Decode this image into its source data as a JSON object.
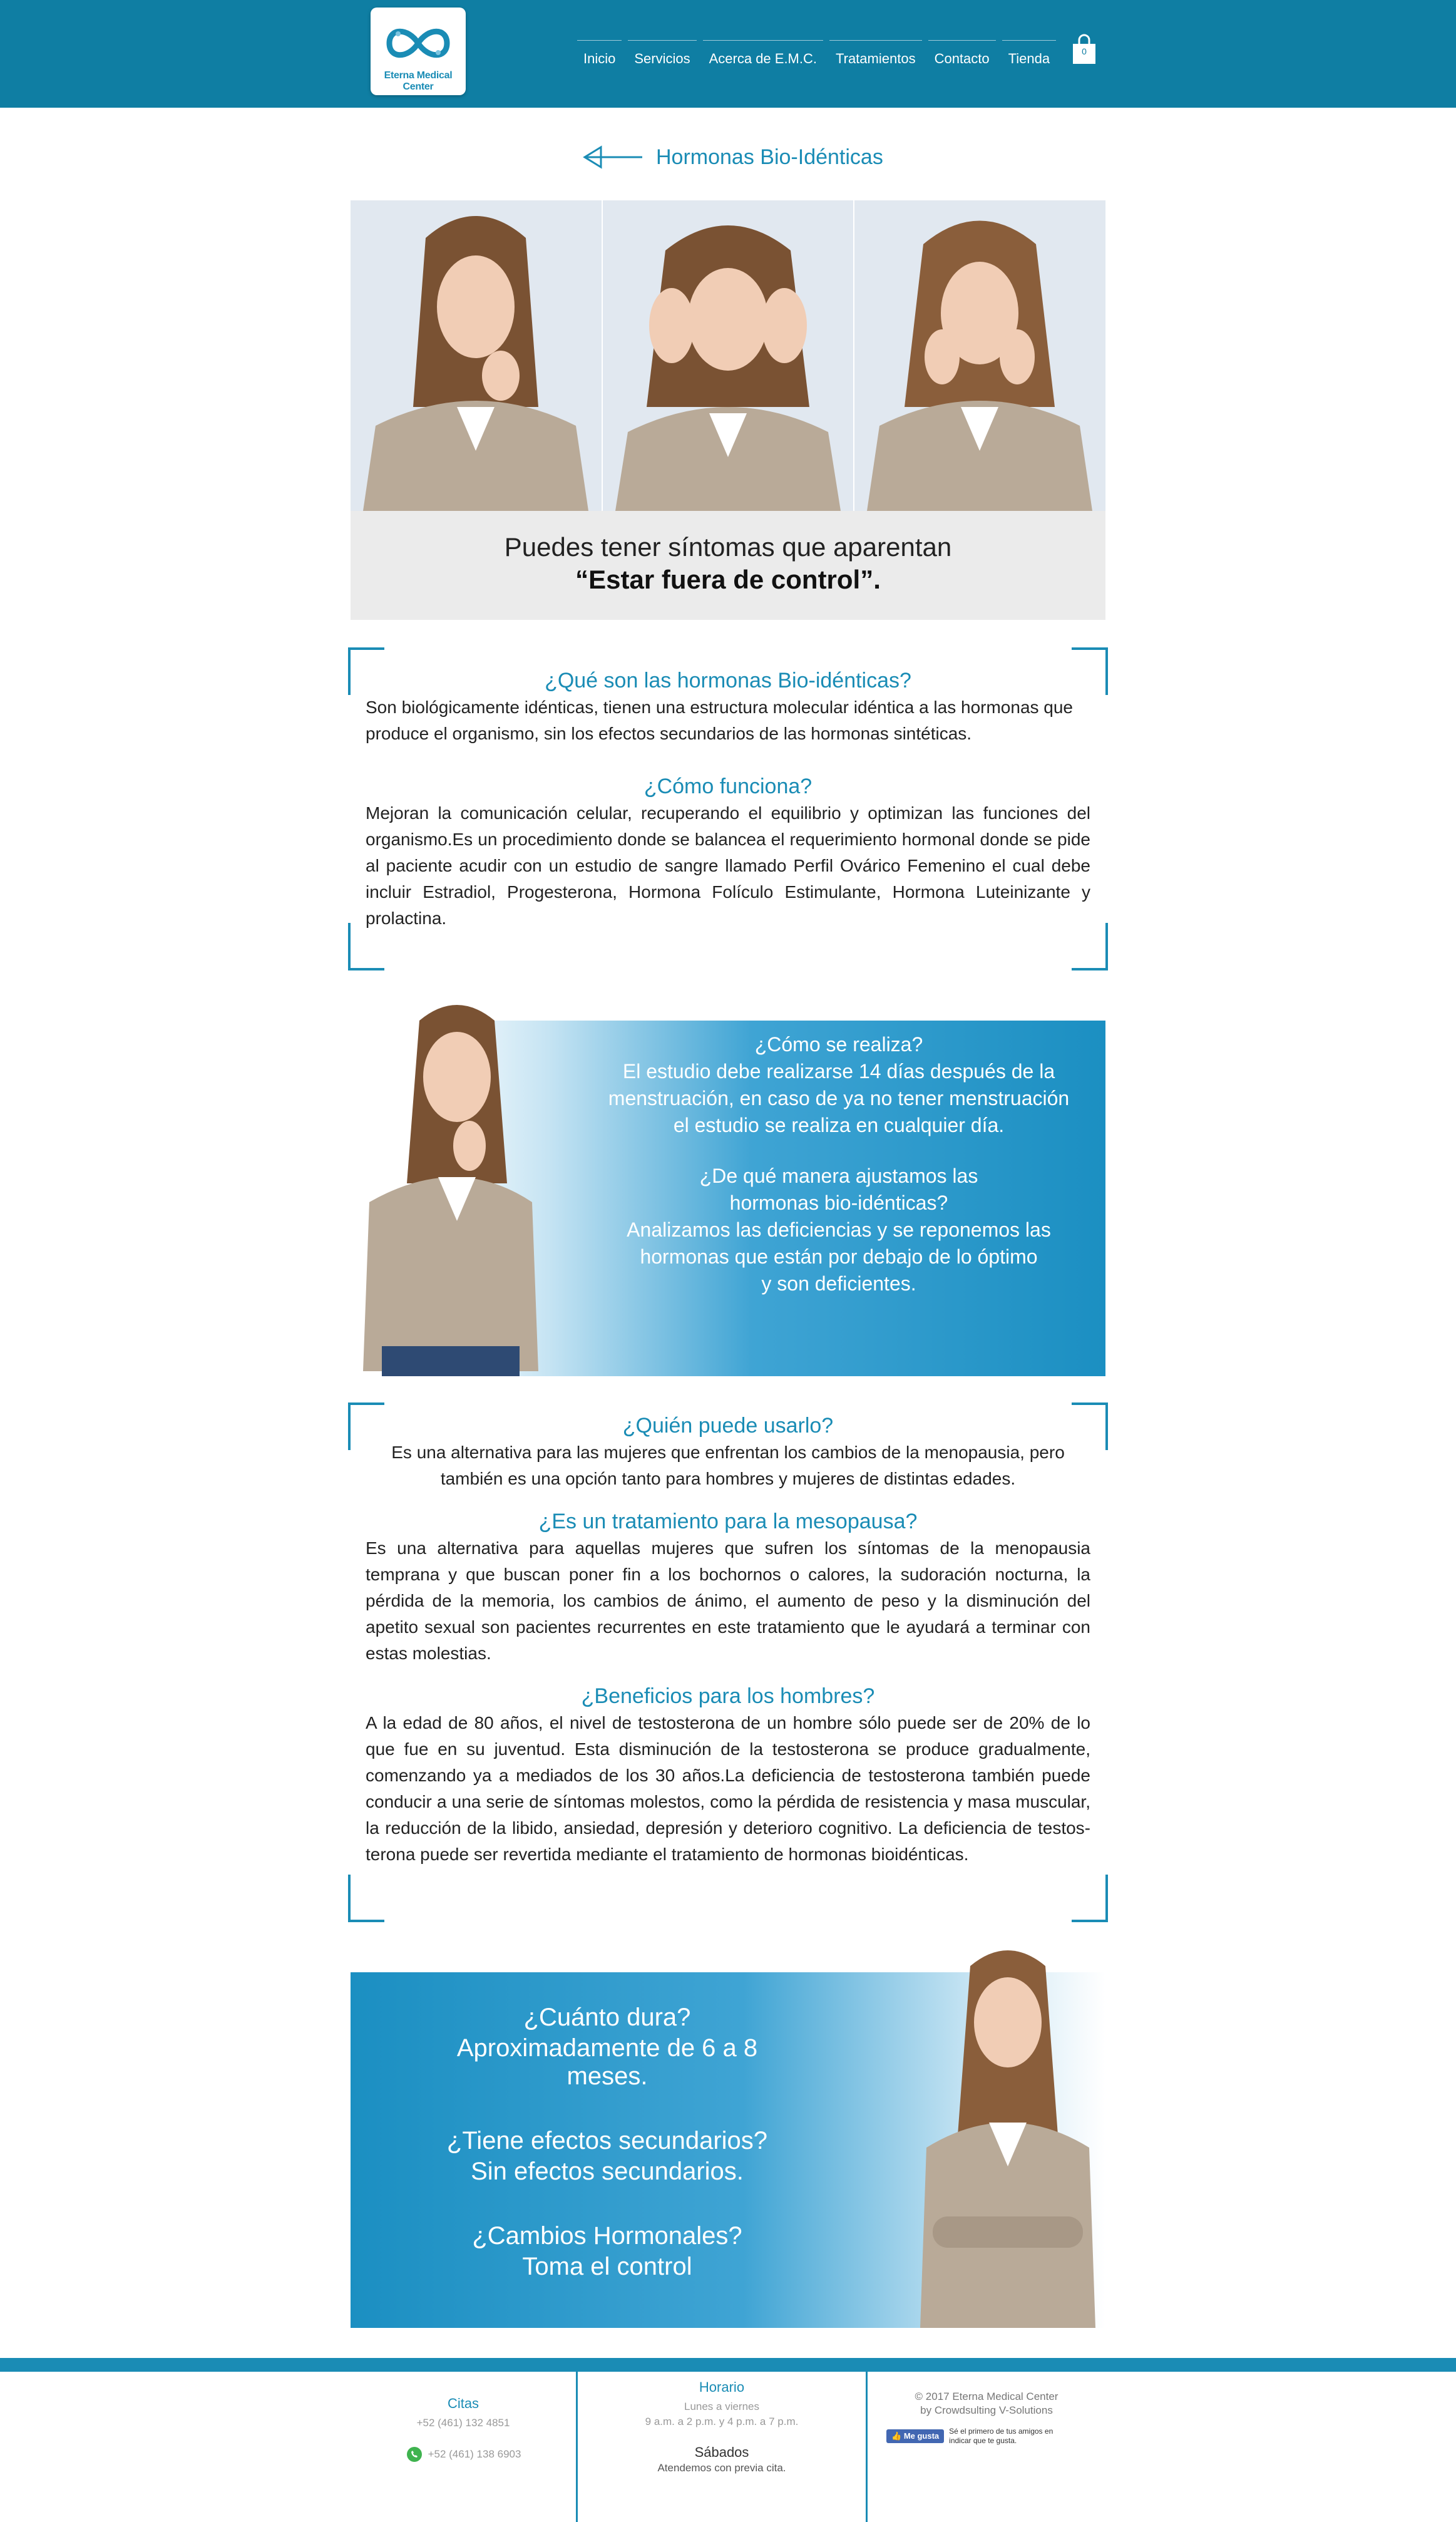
{
  "brand": {
    "logo_text": "Eterna Medical Center"
  },
  "nav": {
    "items": [
      "Inicio",
      "Servicios",
      "Acerca de E.M.C.",
      "Tratamientos",
      "Contacto",
      "Tienda"
    ]
  },
  "cart": {
    "count": "0"
  },
  "page": {
    "title": "Hormonas Bio-Idénticas"
  },
  "hero": {
    "line1": "Puedes tener síntomas que aparentan",
    "line2": "“Estar fuera de control”."
  },
  "section1": {
    "q1": "¿Qué son las hormonas Bio-idénticas?",
    "a1": "Son biológicamente idénticas, tienen una estructura molecular idéntica a las hormonas que produce el organismo, sin los efectos secundarios de las hormonas sintéticas.",
    "q2": "¿Cómo funciona?",
    "a2": "Mejoran la comunicación celular, recuperando el equilibrio y optimizan las funciones del organismo.Es un procedimiento donde se balancea el requerimiento hormonal donde se pide al paciente acudir con un estudio de sangre llamado Perfil Ovárico Femenino el cual debe incluir Estradiol, Progesterona, Hormona Folículo Estimulante, Hormona Luteinizante y prolactina."
  },
  "banner1": {
    "q1": "¿Cómo se realiza?",
    "a1_l1": "El estudio debe realizarse 14 días después de la",
    "a1_l2": "menstruación, en caso de ya no tener menstruación",
    "a1_l3": "el estudio se realiza en cualquier día.",
    "q2_l1": "¿De qué manera ajustamos las",
    "q2_l2": "hormonas bio-idénticas?",
    "a2_l1": "Analizamos las deficiencias y se reponemos las",
    "a2_l2": "hormonas que están por debajo de lo óptimo",
    "a2_l3": "y son deficientes."
  },
  "section2": {
    "q1": "¿Quién puede usarlo?",
    "a1": "Es una alternativa para las mujeres que enfrentan los cambios de la menopausia, pero también es una opción tanto para hombres y mujeres de distintas edades.",
    "q2": "¿Es un tratamiento para la mesopausa?",
    "a2": "Es una alternativa para aquellas mujeres que sufren los síntomas de la menopausia temprana y que buscan poner fin a los bochornos o calores, la sudoración nocturna, la pérdida de la memoria, los cambios de ánimo, el aumento de peso y la disminución del apetito sexual son pacientes recurrentes en este tratamiento que le ayudará a terminar con estas molestias.",
    "q3": "¿Beneficios para los hombres?",
    "a3": "A la edad de 80 años, el nivel de testosterona de un hombre sólo puede ser de 20% de lo que fue en su juventud. Esta disminución de la testosterona se produce gradualmente, comenzando ya a mediados de los 30 años.La deficiencia de testosterona también puede conducir a una serie de síntomas molestos, como la pérdida de resistencia y masa muscular, la reducción de la libido, ansiedad, depresión y deterioro cognitivo. La deficiencia de testos-terona puede ser revertida mediante el tratamiento de hormonas bioidénticas."
  },
  "banner2": {
    "q1": "¿Cuánto dura?",
    "a1": "Aproximadamente de 6 a 8 meses.",
    "q2": "¿Tiene efectos secundarios?",
    "a2": "Sin efectos secundarios.",
    "q3": "¿Cambios Hormonales?",
    "a3": "Toma el control"
  },
  "footer": {
    "citas_title": "Citas",
    "phone1": "+52 (461) 132 4851",
    "phone2": "+52 (461) 138 6903",
    "horario_title": "Horario",
    "weekdays": "Lunes a viernes",
    "weekday_hours": "9 a.m. a 2 p.m. y 4 p.m. a 7 p.m.",
    "saturday": "Sábados",
    "saturday_note": "Atendemos con previa cita.",
    "copyright": "© 2017 Eterna Medical Center",
    "credit": "by Crowdsulting V-Solutions",
    "fb_label": "Me gusta",
    "fb_text1": "Sé el primero de tus amigos en",
    "fb_text2": "indicar que te gusta."
  },
  "colors": {
    "header": "#0f7ea3",
    "accent": "#1a8cb5",
    "banner": "#1b8fc2"
  }
}
